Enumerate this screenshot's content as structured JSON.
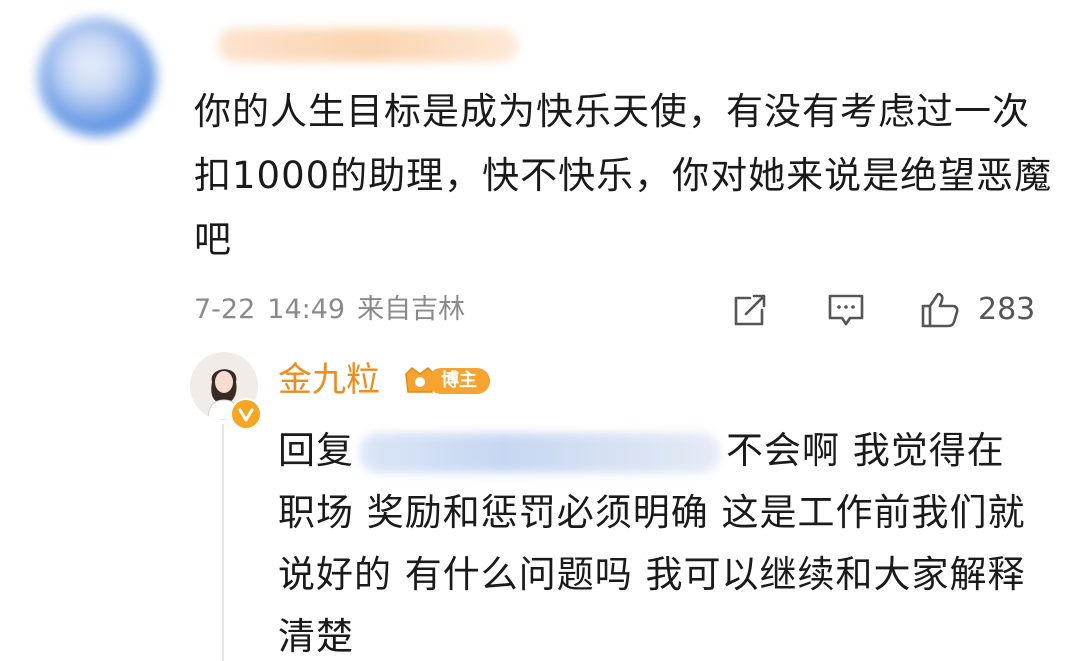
{
  "comment": {
    "text": "你的人生目标是成为快乐天使，有没有考虑过一次扣1000的助理，快不快乐，你对她来说是绝望恶魔吧",
    "date": "7-22",
    "time": "14:49",
    "location": "来自吉林",
    "like_count": "283",
    "icons": [
      "share-icon",
      "comment-icon",
      "like-icon"
    ]
  },
  "reply": {
    "author": "金九粒",
    "badge_label": "博主",
    "reply_prefix": "回复",
    "text": "不会啊 我觉得在职场 奖励和惩罚必须明确 这是工作前我们就说好的 有什么问题吗 我可以继续和大家解释清楚",
    "author_color": "#ef8c1e",
    "badge_color": "#f6a330"
  }
}
